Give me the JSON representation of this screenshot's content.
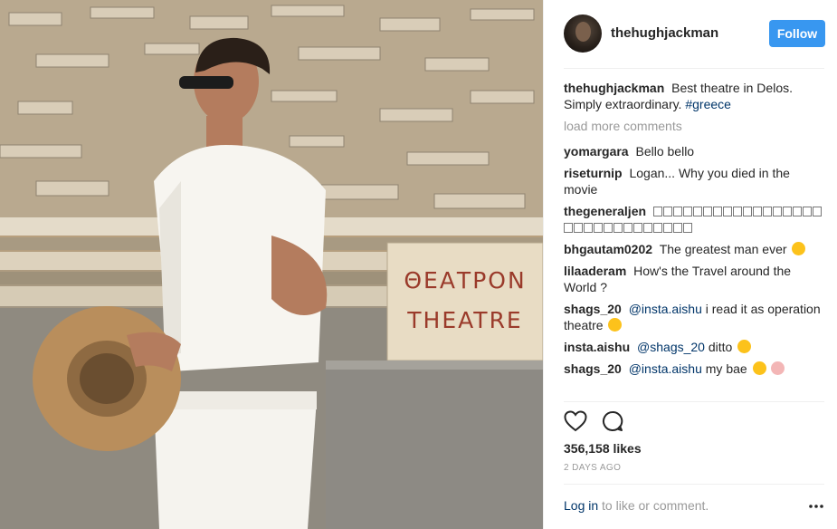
{
  "photo": {
    "sign_line1": "ΘΕΑΤΡΟΝ",
    "sign_line2": "THEATRE"
  },
  "header": {
    "username": "thehughjackman",
    "follow_label": "Follow"
  },
  "caption": {
    "username": "thehughjackman",
    "text": "Best theatre in Delos. Simply extraordinary.",
    "hashtag": "#greece"
  },
  "load_more": "load more comments",
  "comments": [
    {
      "user": "yomargara",
      "text": "Bello bello"
    },
    {
      "user": "riseturnip",
      "text": "Logan... Why you died in the movie"
    },
    {
      "user": "thegeneraljen",
      "text": ""
    },
    {
      "user": "bhgautam0202",
      "text": "The greatest man ever"
    },
    {
      "user": "lilaaderam",
      "text": "How's the Travel around the World ?"
    },
    {
      "user": "shags_20",
      "mention": "@insta.aishu",
      "text": "i read it as operation theatre"
    },
    {
      "user": "insta.aishu",
      "mention": "@shags_20",
      "text": "ditto"
    },
    {
      "user": "shags_20",
      "mention": "@insta.aishu",
      "text": "my bae"
    }
  ],
  "icons": [
    "heart-icon",
    "comment-icon",
    "more-options-icon"
  ],
  "likes": "356,158 likes",
  "date": "2 DAYS AGO",
  "login": {
    "link": "Log in",
    "text": "to like or comment."
  },
  "colors": {
    "follow_button": "#3897f0",
    "link": "#003569",
    "muted": "#999999"
  }
}
